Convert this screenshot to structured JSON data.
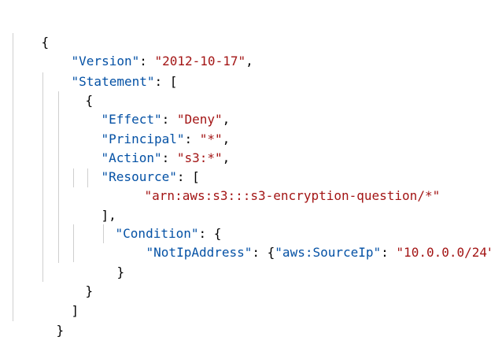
{
  "editor": {
    "lines": [
      {
        "text": "{"
      },
      {
        "key": "\"Version\"",
        "sep": ": ",
        "val": "\"2012-10-17\"",
        "tail": ","
      },
      {
        "key": "\"Statement\"",
        "sep": ": [",
        "val": "",
        "tail": ""
      },
      {
        "text": "{"
      },
      {
        "key": "\"Effect\"",
        "sep": ": ",
        "val": "\"Deny\"",
        "tail": ","
      },
      {
        "key": "\"Principal\"",
        "sep": ": ",
        "val": "\"*\"",
        "tail": ","
      },
      {
        "key": "\"Action\"",
        "sep": ": ",
        "val": "\"s3:*\"",
        "tail": ","
      },
      {
        "key": "\"Resource\"",
        "sep": ": [",
        "val": "",
        "tail": ""
      },
      {
        "val": "\"arn:aws:s3:::s3-encryption-question/*\""
      },
      {
        "text": "],"
      },
      {
        "key": "\"Condition\"",
        "sep": ": {",
        "val": "",
        "tail": ""
      },
      {
        "key": "\"NotIpAddress\"",
        "sep": ": {",
        "key2": "\"aws:SourceIp\"",
        "sep2": ": ",
        "val": "\"10.0.0.0/24\"",
        "tail": "}"
      },
      {
        "text": "}"
      },
      {
        "text": "}"
      },
      {
        "text": "]"
      },
      {
        "text": "}"
      }
    ]
  },
  "colors": {
    "key": "#0451a5",
    "string": "#a31515",
    "punctuation": "#000000",
    "indent_guide": "#cfcfcf"
  }
}
